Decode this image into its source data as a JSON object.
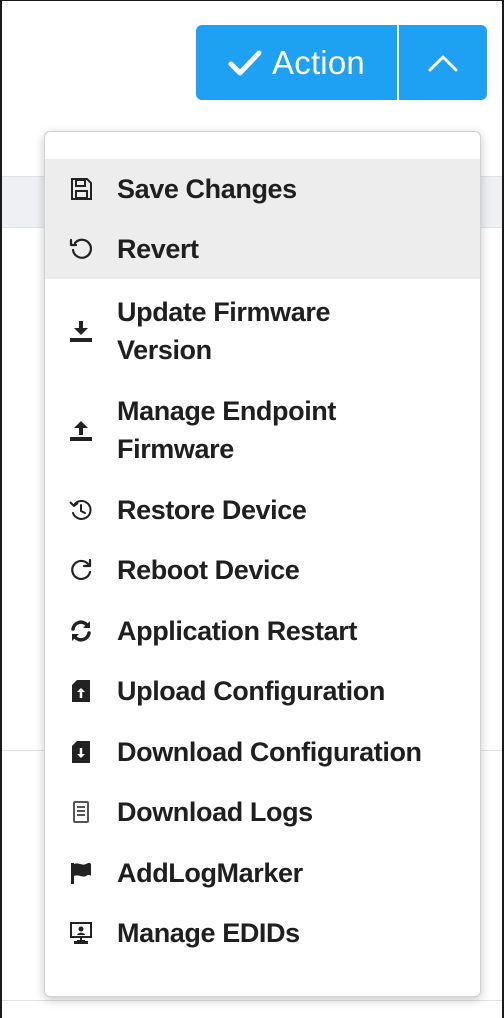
{
  "toolbar": {
    "action_label": "Action",
    "accent_color": "#1ea0f3"
  },
  "menu": {
    "items": [
      {
        "label": "Save Changes",
        "icon": "save-icon"
      },
      {
        "label": "Revert",
        "icon": "revert-icon"
      },
      {
        "label": "Update Firmware Version",
        "icon": "download-icon"
      },
      {
        "label": "Manage Endpoint Firmware",
        "icon": "upload-icon"
      },
      {
        "label": "Restore Device",
        "icon": "history-icon"
      },
      {
        "label": "Reboot Device",
        "icon": "reboot-icon"
      },
      {
        "label": "Application Restart",
        "icon": "sync-icon"
      },
      {
        "label": "Upload Configuration",
        "icon": "file-upload-icon"
      },
      {
        "label": "Download Configuration",
        "icon": "file-download-icon"
      },
      {
        "label": "Download Logs",
        "icon": "log-file-icon"
      },
      {
        "label": "AddLogMarker",
        "icon": "flag-icon"
      },
      {
        "label": "Manage EDIDs",
        "icon": "monitor-icon"
      }
    ]
  }
}
